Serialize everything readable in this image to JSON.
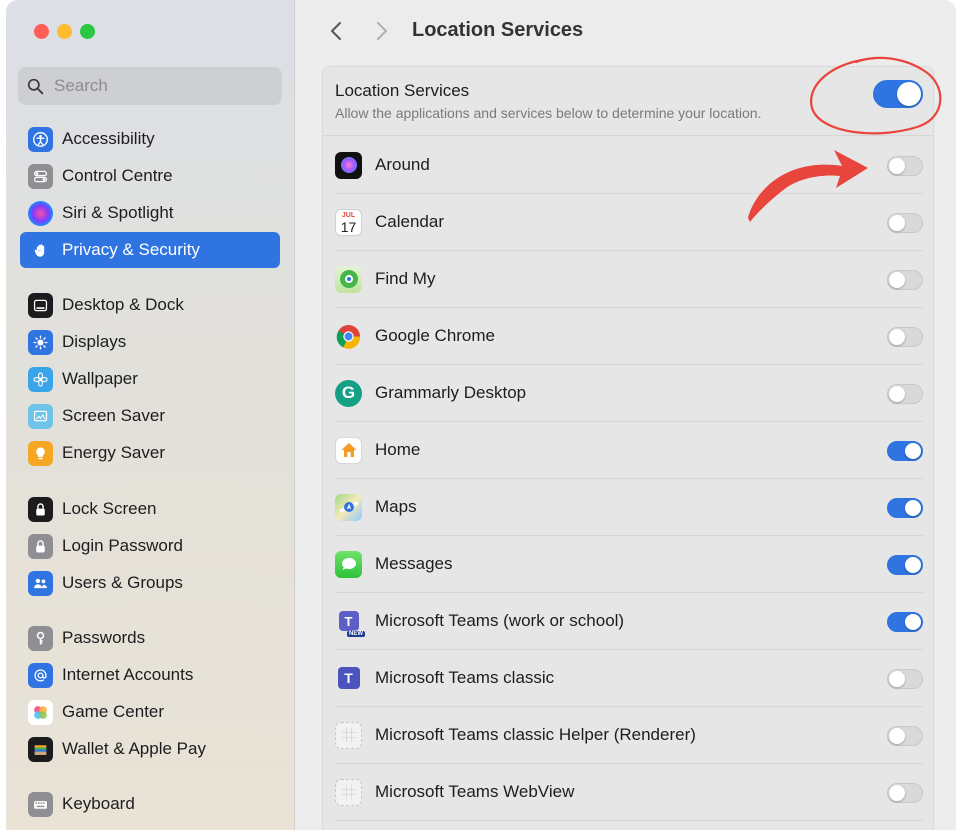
{
  "colors": {
    "accent": "#2f74e0",
    "annotation": "#e8453c"
  },
  "sidebar": {
    "search_placeholder": "Search",
    "items": [
      {
        "label": "Accessibility",
        "icon": "accessibility-icon",
        "color": "#2f74e0"
      },
      {
        "label": "Control Centre",
        "icon": "control-centre-icon",
        "color": "#8e8e93"
      },
      {
        "label": "Siri & Spotlight",
        "icon": "siri-icon",
        "color": "#222222"
      },
      {
        "label": "Privacy & Security",
        "icon": "hand-icon",
        "color": "#2f74e0",
        "selected": true
      },
      {
        "label": "Desktop & Dock",
        "icon": "dock-icon",
        "color": "#1c1c1e"
      },
      {
        "label": "Displays",
        "icon": "sun-icon",
        "color": "#2f74e0"
      },
      {
        "label": "Wallpaper",
        "icon": "flower-icon",
        "color": "#3aa4e8"
      },
      {
        "label": "Screen Saver",
        "icon": "screen-saver-icon",
        "color": "#6ec3e8"
      },
      {
        "label": "Energy Saver",
        "icon": "bulb-icon",
        "color": "#f5a623"
      },
      {
        "label": "Lock Screen",
        "icon": "lock-icon",
        "color": "#1c1c1e"
      },
      {
        "label": "Login Password",
        "icon": "padlock-icon",
        "color": "#8e8e93"
      },
      {
        "label": "Users & Groups",
        "icon": "users-icon",
        "color": "#2f74e0"
      },
      {
        "label": "Passwords",
        "icon": "key-icon",
        "color": "#8e8e93"
      },
      {
        "label": "Internet Accounts",
        "icon": "at-icon",
        "color": "#2f74e0"
      },
      {
        "label": "Game Center",
        "icon": "game-center-icon",
        "color": "#ffffff"
      },
      {
        "label": "Wallet & Apple Pay",
        "icon": "wallet-icon",
        "color": "#1c1c1e"
      },
      {
        "label": "Keyboard",
        "icon": "keyboard-icon",
        "color": "#8e8e93"
      }
    ]
  },
  "header": {
    "title": "Location Services"
  },
  "location": {
    "title": "Location Services",
    "description": "Allow the applications and services below to determine your location.",
    "enabled": true
  },
  "apps": [
    {
      "name": "Around",
      "icon": "around-icon",
      "on": false
    },
    {
      "name": "Calendar",
      "icon": "calendar-icon",
      "on": false,
      "month": "JUL",
      "day": "17"
    },
    {
      "name": "Find My",
      "icon": "find-my-icon",
      "on": false
    },
    {
      "name": "Google Chrome",
      "icon": "chrome-icon",
      "on": false
    },
    {
      "name": "Grammarly Desktop",
      "icon": "grammarly-icon",
      "on": false,
      "glyph": "G"
    },
    {
      "name": "Home",
      "icon": "home-icon",
      "on": true
    },
    {
      "name": "Maps",
      "icon": "maps-icon",
      "on": true
    },
    {
      "name": "Messages",
      "icon": "messages-icon",
      "on": true
    },
    {
      "name": "Microsoft Teams (work or school)",
      "icon": "teams-new-icon",
      "on": true,
      "badge": "NEW"
    },
    {
      "name": "Microsoft Teams classic",
      "icon": "teams-icon",
      "on": false
    },
    {
      "name": "Microsoft Teams classic Helper (Renderer)",
      "icon": "generic-app-icon",
      "on": false
    },
    {
      "name": "Microsoft Teams WebView",
      "icon": "generic-app-icon",
      "on": false
    }
  ]
}
